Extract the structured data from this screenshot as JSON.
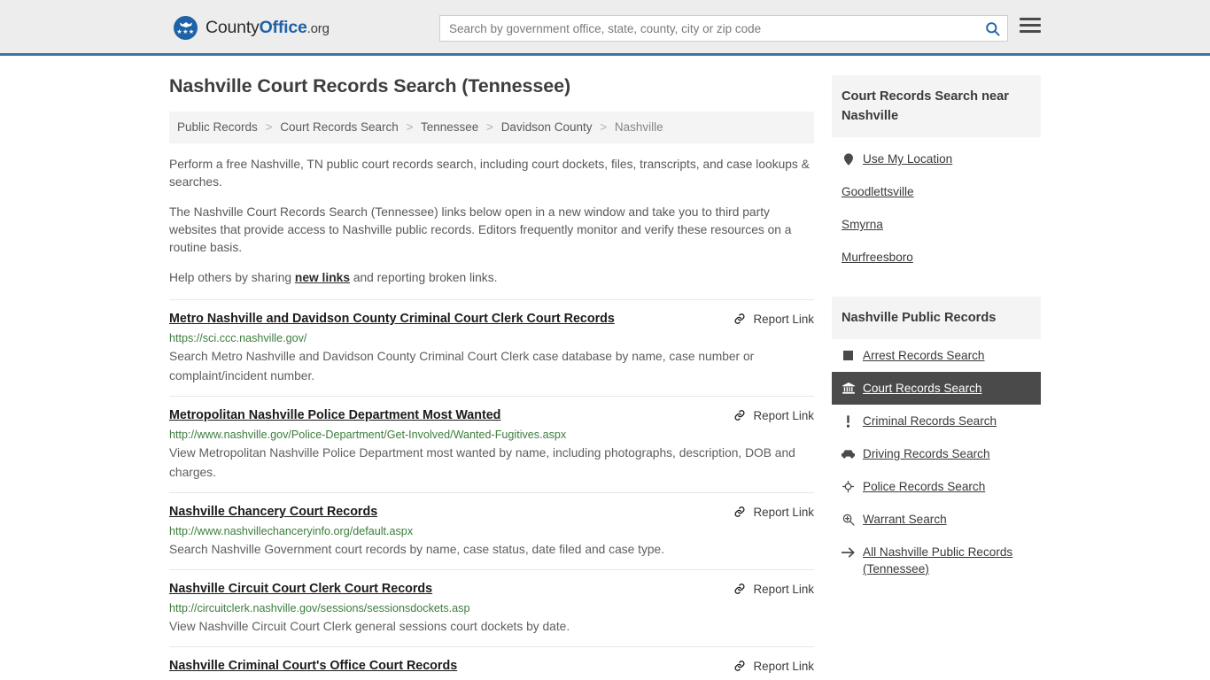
{
  "header": {
    "logo": {
      "part1": "County",
      "part2": "Office",
      "part3": ".org",
      "icon": "eagle-shield-logo"
    },
    "search": {
      "placeholder": "Search by government office, state, county, city or zip code",
      "value": "",
      "button_icon": "search-icon"
    },
    "menu_icon": "hamburger-menu-icon",
    "accent_color": "#3a74a5"
  },
  "main": {
    "title": "Nashville Court Records Search (Tennessee)",
    "breadcrumb": [
      {
        "label": "Public Records",
        "current": false
      },
      {
        "label": "Court Records Search",
        "current": false
      },
      {
        "label": "Tennessee",
        "current": false
      },
      {
        "label": "Davidson County",
        "current": false
      },
      {
        "label": "Nashville",
        "current": true
      }
    ],
    "breadcrumb_separator": ">",
    "intro": [
      "Perform a free Nashville, TN public court records search, including court dockets, files, transcripts, and case lookups & searches.",
      "The Nashville Court Records Search (Tennessee) links below open in a new window and take you to third party websites that provide access to Nashville public records. Editors frequently monitor and verify these resources on a routine basis."
    ],
    "help_prefix": "Help others by sharing ",
    "help_link": "new links",
    "help_suffix": " and reporting broken links.",
    "report_label": "Report Link",
    "report_icon": "broken-link-icon",
    "results": [
      {
        "title": "Metro Nashville and Davidson County Criminal Court Clerk Court Records",
        "url": "https://sci.ccc.nashville.gov/",
        "description": "Search Metro Nashville and Davidson County Criminal Court Clerk case database by name, case number or complaint/incident number."
      },
      {
        "title": "Metropolitan Nashville Police Department Most Wanted",
        "url": "http://www.nashville.gov/Police-Department/Get-Involved/Wanted-Fugitives.aspx",
        "description": "View Metropolitan Nashville Police Department most wanted by name, including photographs, description, DOB and charges."
      },
      {
        "title": "Nashville Chancery Court Records",
        "url": "http://www.nashvillechanceryinfo.org/default.aspx",
        "description": "Search Nashville Government court records by name, case status, date filed and case type."
      },
      {
        "title": "Nashville Circuit Court Clerk Court Records",
        "url": "http://circuitclerk.nashville.gov/sessions/sessionsdockets.asp",
        "description": "View Nashville Circuit Court Clerk general sessions court dockets by date."
      },
      {
        "title": "Nashville Criminal Court's Office Court Records",
        "url": "",
        "description": ""
      }
    ]
  },
  "sidebar": {
    "nearby": {
      "heading": "Court Records Search near Nashville",
      "items": [
        {
          "label": "Use My Location",
          "icon": "map-pin-icon"
        },
        {
          "label": "Goodlettsville",
          "icon": ""
        },
        {
          "label": "Smyrna",
          "icon": ""
        },
        {
          "label": "Murfreesboro",
          "icon": ""
        }
      ]
    },
    "public_records": {
      "heading": "Nashville Public Records",
      "active_color": "#4a4a4a",
      "items": [
        {
          "label": "Arrest Records Search",
          "icon": "square-icon",
          "active": false
        },
        {
          "label": "Court Records Search",
          "icon": "courthouse-icon",
          "active": true
        },
        {
          "label": "Criminal Records Search",
          "icon": "exclamation-icon",
          "active": false
        },
        {
          "label": "Driving Records Search",
          "icon": "car-icon",
          "active": false
        },
        {
          "label": "Police Records Search",
          "icon": "police-badge-icon",
          "active": false
        },
        {
          "label": "Warrant Search",
          "icon": "magnifier-plus-icon",
          "active": false
        },
        {
          "label": "All Nashville Public Records (Tennessee)",
          "icon": "arrow-right-icon",
          "active": false
        }
      ]
    }
  }
}
